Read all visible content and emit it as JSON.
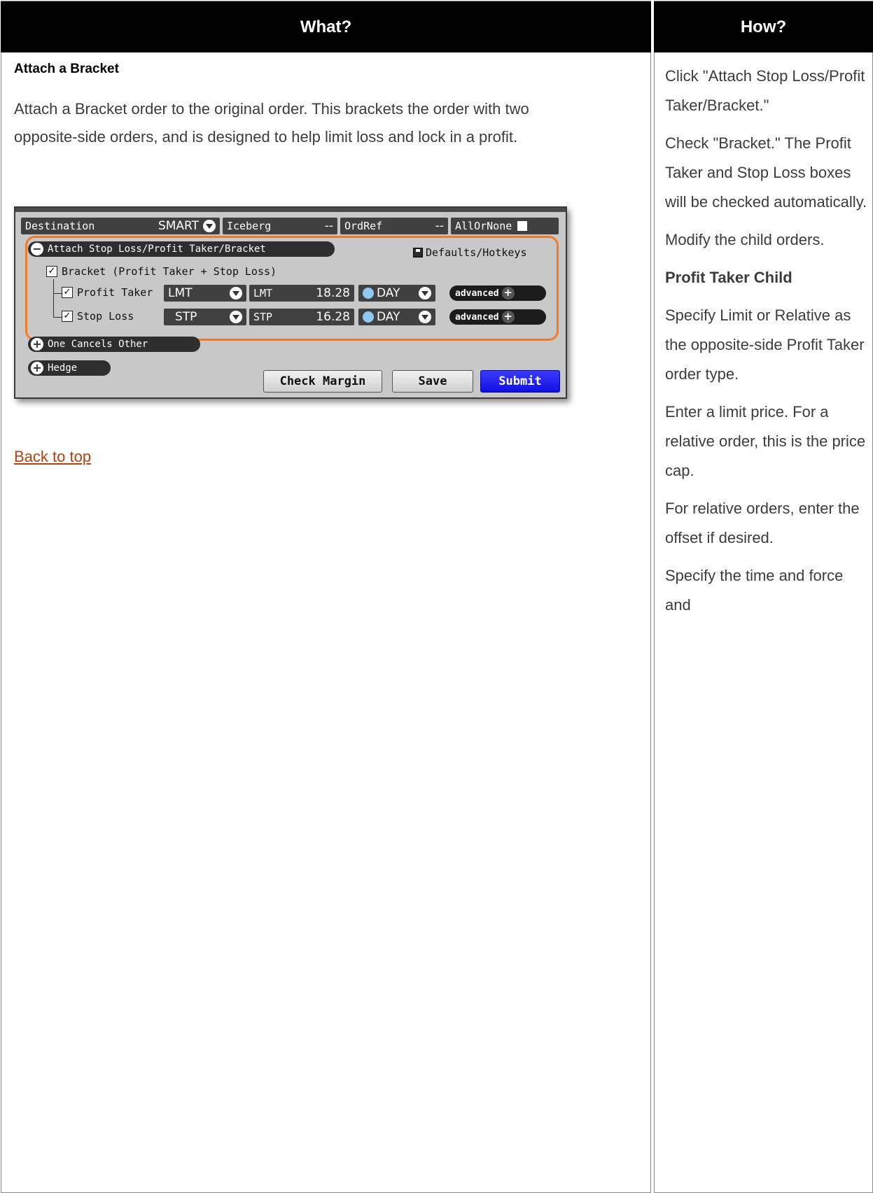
{
  "table": {
    "what_header": "What?",
    "how_header": "How?"
  },
  "what": {
    "section_title": "Attach a Bracket",
    "description_line1": "Attach a Bracket order to the original order. This brackets the order with two",
    "description_line2": "opposite-side orders, and is designed to help limit loss and lock in a profit.",
    "back_link": "Back to top"
  },
  "panel": {
    "destination_label": "Destination",
    "destination_value": "SMART",
    "iceberg_label": "Iceberg",
    "iceberg_value": "--",
    "ordref_label": "OrdRef",
    "ordref_value": "--",
    "allornone_label": "AllOrNone",
    "attach_label": "Attach Stop Loss/Profit Taker/Bracket",
    "defaults_label": "Defaults/Hotkeys",
    "bracket_label": "Bracket (Profit Taker + Stop Loss)",
    "profit_taker": {
      "label": "Profit Taker",
      "type": "LMT",
      "price_label": "LMT",
      "price": "18.28",
      "tif": "DAY",
      "advanced": "advanced"
    },
    "stop_loss": {
      "label": "Stop Loss",
      "type": "STP",
      "price_label": "STP",
      "price": "16.28",
      "tif": "DAY",
      "advanced": "advanced"
    },
    "oco_label": "One Cancels Other",
    "hedge_label": "Hedge",
    "check_margin_label": "Check Margin",
    "save_label": "Save",
    "submit_label": "Submit"
  },
  "how": {
    "step1": "Click \"Attach Stop Loss/Profit Taker/Bracket.\"",
    "step2": "Check \"Bracket.\" The Profit Taker and Stop Loss boxes will be checked automatically.",
    "step3": "Modify the child orders.",
    "subhead": "Profit Taker Child",
    "step4": "Specify Limit or Relative as the opposite-side Profit Taker order type.",
    "step5": "Enter a limit price. For a relative order, this is the price cap.",
    "step6": "For relative orders, enter the offset if desired.",
    "step7": "Specify the time and force and"
  }
}
